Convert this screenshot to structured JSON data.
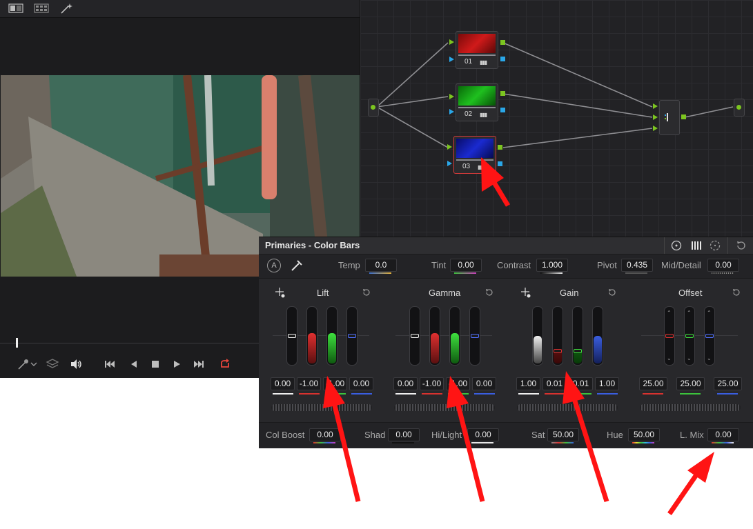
{
  "viewer": {
    "toolbar_icons": [
      "split-view-icon",
      "gallery-grid-icon",
      "magic-wand-icon"
    ],
    "transport_icons": [
      "picker-icon",
      "layers-icon",
      "speaker-icon",
      "skip-first-icon",
      "step-back-icon",
      "stop-icon",
      "play-icon",
      "skip-last-icon",
      "loop-icon"
    ],
    "loop_color": "#e8453c"
  },
  "node_graph": {
    "nodes": [
      {
        "label": "01",
        "thumb_color": "#c01515"
      },
      {
        "label": "02",
        "thumb_color": "#14b014"
      },
      {
        "label": "03",
        "thumb_color": "#1020c8"
      }
    ],
    "selected_node": "03"
  },
  "panel": {
    "title": "Primaries - Color Bars",
    "header_icons": [
      "target-icon",
      "bars-icon",
      "wheels-icon",
      "reset-icon"
    ],
    "auto_label": "A",
    "adjust": {
      "temp": {
        "label": "Temp",
        "value": "0.0"
      },
      "tint": {
        "label": "Tint",
        "value": "0.00"
      },
      "contrast": {
        "label": "Contrast",
        "value": "1.000"
      },
      "pivot": {
        "label": "Pivot",
        "value": "0.435"
      },
      "middetail": {
        "label": "Mid/Detail",
        "value": "0.00"
      }
    },
    "wheels": [
      {
        "name": "Lift",
        "values": [
          "0.00",
          "-1.00",
          "-1.00",
          "0.00"
        ]
      },
      {
        "name": "Gamma",
        "values": [
          "0.00",
          "-1.00",
          "-1.00",
          "0.00"
        ]
      },
      {
        "name": "Gain",
        "values": [
          "1.00",
          "0.01",
          "0.01",
          "1.00"
        ]
      },
      {
        "name": "Offset",
        "values": [
          "25.00",
          "25.00",
          "25.00"
        ]
      }
    ],
    "bottom": {
      "colboost": {
        "label": "Col Boost",
        "value": "0.00"
      },
      "shad": {
        "label": "Shad",
        "value": "0.00"
      },
      "hilight": {
        "label": "Hi/Light",
        "value": "0.00"
      },
      "sat": {
        "label": "Sat",
        "value": "50.00"
      },
      "hue": {
        "label": "Hue",
        "value": "50.00"
      },
      "lmix": {
        "label": "L. Mix",
        "value": "0.00"
      }
    }
  },
  "colors": {
    "red": "#d8322f",
    "green": "#3cc33c",
    "blue": "#3a5ee0",
    "white": "#f0f0f0",
    "annotation": "#ff1414"
  }
}
